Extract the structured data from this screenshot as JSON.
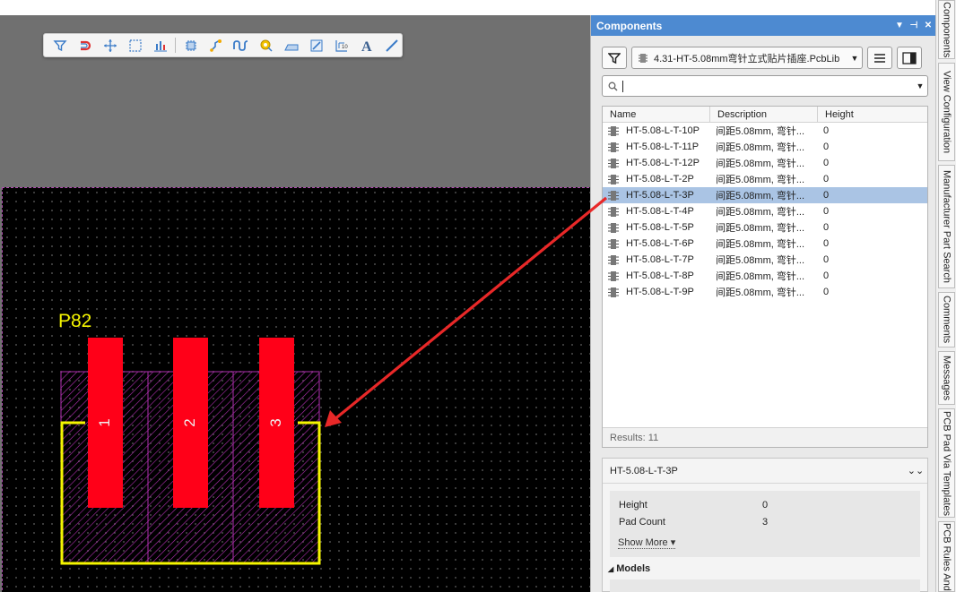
{
  "toolbar": {
    "tools": [
      "filter-icon",
      "snap-magnet-icon",
      "move-cross-icon",
      "select-rect-icon",
      "align-bars-icon",
      "component-icon",
      "route-track-icon",
      "interactive-route-icon",
      "pad-icon",
      "fill-region-icon",
      "polygon-pour-icon",
      "dimension-icon",
      "text-icon",
      "line-icon"
    ]
  },
  "pcb": {
    "designator": "P82",
    "pads": [
      "1",
      "2",
      "3"
    ],
    "colors": {
      "pad": "#ff0018",
      "silk": "#f5f500",
      "courtyard": "#b12fb1",
      "board": "#000000",
      "arrow": "#e82828"
    }
  },
  "panel": {
    "title": "Components",
    "header_controls": [
      "▼",
      "⊣",
      "✕"
    ],
    "library": "4.31-HT-5.08mm弯针立式贴片插座.PcbLib",
    "search_value": "",
    "columns": [
      "Name",
      "Description",
      "Height"
    ],
    "rows": [
      {
        "name": "HT-5.08-L-T-10P",
        "desc": "间距5.08mm, 弯针...",
        "height": "0"
      },
      {
        "name": "HT-5.08-L-T-11P",
        "desc": "间距5.08mm, 弯针...",
        "height": "0"
      },
      {
        "name": "HT-5.08-L-T-12P",
        "desc": "间距5.08mm, 弯针...",
        "height": "0"
      },
      {
        "name": "HT-5.08-L-T-2P",
        "desc": "间距5.08mm, 弯针...",
        "height": "0"
      },
      {
        "name": "HT-5.08-L-T-3P",
        "desc": "间距5.08mm, 弯针...",
        "height": "0",
        "selected": true
      },
      {
        "name": "HT-5.08-L-T-4P",
        "desc": "间距5.08mm, 弯针...",
        "height": "0"
      },
      {
        "name": "HT-5.08-L-T-5P",
        "desc": "间距5.08mm, 弯针...",
        "height": "0"
      },
      {
        "name": "HT-5.08-L-T-6P",
        "desc": "间距5.08mm, 弯针...",
        "height": "0"
      },
      {
        "name": "HT-5.08-L-T-7P",
        "desc": "间距5.08mm, 弯针...",
        "height": "0"
      },
      {
        "name": "HT-5.08-L-T-8P",
        "desc": "间距5.08mm, 弯针...",
        "height": "0"
      },
      {
        "name": "HT-5.08-L-T-9P",
        "desc": "间距5.08mm, 弯针...",
        "height": "0"
      }
    ],
    "results": "Results: 11",
    "details": {
      "title": "HT-5.08-L-T-3P",
      "props": [
        {
          "key": "Height",
          "value": "0"
        },
        {
          "key": "Pad Count",
          "value": "3"
        }
      ],
      "show_more": "Show More ▾",
      "models_label": "Models"
    }
  },
  "right_tabs": [
    "Components",
    "View Configuration",
    "Manufacturer Part Search",
    "Comments",
    "Messages",
    "PCB Pad Via Templates",
    "PCB Rules And"
  ]
}
